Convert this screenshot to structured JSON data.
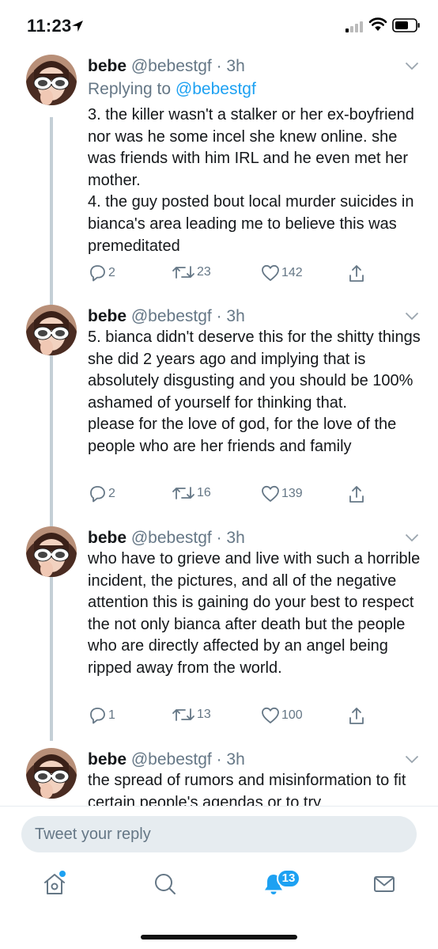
{
  "status": {
    "time": "11:23"
  },
  "colors": {
    "accent": "#1da1f2",
    "muted": "#657786"
  },
  "tweets": [
    {
      "name": "bebe",
      "handle": "@bebestgf",
      "time": "3h",
      "reply_prefix": "Replying to ",
      "reply_handle": "@bebestgf",
      "text": "3. the killer wasn't a stalker or her ex-boyfriend nor was he some incel she knew online. she was friends with him IRL and he even met her mother.\n4. the guy posted bout local murder suicides in bianca's area leading me to believe this was premeditated",
      "replies": "2",
      "retweets": "23",
      "likes": "142"
    },
    {
      "name": "bebe",
      "handle": "@bebestgf",
      "time": "3h",
      "text": "5. bianca didn't deserve this for the shitty things she did 2 years ago and implying that is absolutely disgusting and you should be 100% ashamed of yourself for thinking that.\nplease for the love of god, for the love of the people who are her friends and family",
      "replies": "2",
      "retweets": "16",
      "likes": "139"
    },
    {
      "name": "bebe",
      "handle": "@bebestgf",
      "time": "3h",
      "text": "who have to grieve and live with such a horrible incident, the pictures, and all of the negative attention this is gaining do your best to respect the not only bianca after death but the people who are directly affected by an angel being ripped away from the world.",
      "replies": "1",
      "retweets": "13",
      "likes": "100"
    },
    {
      "name": "bebe",
      "handle": "@bebestgf",
      "time": "3h",
      "text": "the spread of rumors and misinformation to fit certain people's agendas or to try"
    }
  ],
  "composer": {
    "placeholder": "Tweet your reply"
  },
  "tabs": [
    {
      "icon": "home-icon"
    },
    {
      "icon": "search-icon"
    },
    {
      "icon": "notifications-icon",
      "badge": "13"
    },
    {
      "icon": "messages-icon"
    }
  ]
}
